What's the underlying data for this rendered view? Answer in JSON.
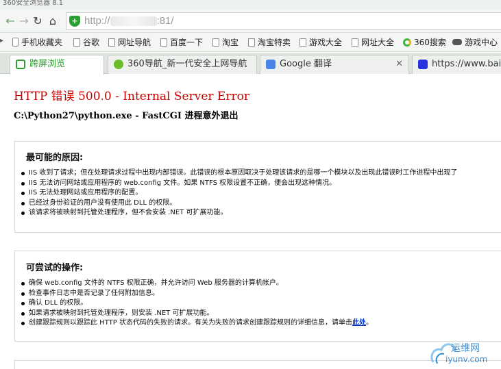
{
  "window": {
    "title": "360安全浏览器 8.1"
  },
  "nav": {
    "back_icon": "back-arrow-icon",
    "forward_icon": "forward-arrow-icon",
    "reload_icon": "reload-icon",
    "home_icon": "home-icon",
    "address_prefix": "http://",
    "address_suffix": ":81/"
  },
  "bookmarks": [
    {
      "label": "手机收藏夹",
      "icon": "phone-icon"
    },
    {
      "label": "谷歌",
      "icon": "page-icon"
    },
    {
      "label": "网址导航",
      "icon": "page-icon"
    },
    {
      "label": "百度一下",
      "icon": "page-icon"
    },
    {
      "label": "淘宝",
      "icon": "page-icon"
    },
    {
      "label": "淘宝特卖",
      "icon": "page-icon"
    },
    {
      "label": "游戏大全",
      "icon": "page-icon"
    },
    {
      "label": "网址大全",
      "icon": "page-icon"
    },
    {
      "label": "360搜索",
      "icon": "360-icon"
    },
    {
      "label": "游戏中心",
      "icon": "gamepad-icon"
    }
  ],
  "tabs": [
    {
      "label": "跨屏浏览",
      "active": true
    },
    {
      "label": "360导航_新一代安全上网导航",
      "active": false
    },
    {
      "label": "Google 翻译",
      "active": false
    },
    {
      "label": "https://www.baidu",
      "active": false
    }
  ],
  "page": {
    "error_title": "HTTP 错误 500.0 - Internal Server Error",
    "error_subtitle": "C:\\Python27\\python.exe - FastCGI 进程意外退出",
    "causes_heading": "最可能的原因:",
    "causes": [
      "IIS 收到了请求；但在处理请求过程中出现内部错误。此错误的根本原因取决于处理该请求的是哪一个模块以及出现此错误时工作进程中出现了",
      "IIS 无法访问网站或应用程序的 web.config 文件。如果 NTFS 权限设置不正确，便会出现这种情况。",
      "IIS 无法处理网站或应用程序的配置。",
      "已经过身份验证的用户没有使用此 DLL 的权限。",
      "该请求将被映射到托管处理程序，但不会安装 .NET 可扩展功能。"
    ],
    "actions_heading": "可尝试的操作:",
    "actions": [
      "确保 web.config 文件的 NTFS 权限正确，并允许访问 Web 服务器的计算机帐户。",
      "检查事件日志中是否记录了任何附加信息。",
      "确认 DLL 的权限。",
      "如果请求被映射到托管处理程序，则安装 .NET 可扩展功能。"
    ],
    "last_action_text": "创建跟踪规则以跟踪此 HTTP 状态代码的失败的请求。有关为失败的请求创建跟踪规则的详细信息，请单击",
    "last_action_link": "此处",
    "last_action_end": "。"
  },
  "watermark": {
    "line1": "运维网",
    "line2": "iyunv.com"
  },
  "colors": {
    "error_red": "#cc0000",
    "active_tab_green": "#2a9d2a",
    "link_blue": "#0033cc",
    "shield_green": "#2aa033"
  }
}
